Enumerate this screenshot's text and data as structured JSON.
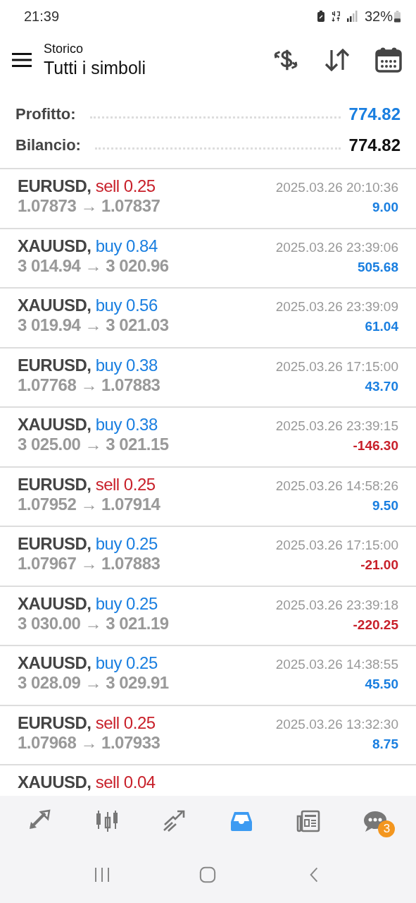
{
  "status_bar": {
    "time": "21:39",
    "battery": "32%"
  },
  "header": {
    "subtitle": "Storico",
    "title": "Tutti i simboli"
  },
  "summary": [
    {
      "label": "Profitto:",
      "value": "774.82",
      "kind": "accent"
    },
    {
      "label": "Bilancio:",
      "value": "774.82",
      "kind": "plain"
    }
  ],
  "deals": [
    {
      "symbol": "EURUSD,",
      "side": "sell",
      "kind": "sell",
      "volume": "0.25",
      "time": "2025.03.26 20:10:36",
      "prices": "1.07873 → 1.07837",
      "profit": "9.00",
      "loss": false
    },
    {
      "symbol": "XAUUSD,",
      "side": "buy",
      "kind": "buy",
      "volume": "0.84",
      "time": "2025.03.26 23:39:06",
      "prices": "3 014.94 → 3 020.96",
      "profit": "505.68",
      "loss": false
    },
    {
      "symbol": "XAUUSD,",
      "side": "buy",
      "kind": "buy",
      "volume": "0.56",
      "time": "2025.03.26 23:39:09",
      "prices": "3 019.94 → 3 021.03",
      "profit": "61.04",
      "loss": false
    },
    {
      "symbol": "EURUSD,",
      "side": "buy",
      "kind": "buy",
      "volume": "0.38",
      "time": "2025.03.26 17:15:00",
      "prices": "1.07768 → 1.07883",
      "profit": "43.70",
      "loss": false
    },
    {
      "symbol": "XAUUSD,",
      "side": "buy",
      "kind": "buy",
      "volume": "0.38",
      "time": "2025.03.26 23:39:15",
      "prices": "3 025.00 → 3 021.15",
      "profit": "-146.30",
      "loss": true
    },
    {
      "symbol": "EURUSD,",
      "side": "sell",
      "kind": "sell",
      "volume": "0.25",
      "time": "2025.03.26 14:58:26",
      "prices": "1.07952 → 1.07914",
      "profit": "9.50",
      "loss": false
    },
    {
      "symbol": "EURUSD,",
      "side": "buy",
      "kind": "buy",
      "volume": "0.25",
      "time": "2025.03.26 17:15:00",
      "prices": "1.07967 → 1.07883",
      "profit": "-21.00",
      "loss": true
    },
    {
      "symbol": "XAUUSD,",
      "side": "buy",
      "kind": "buy",
      "volume": "0.25",
      "time": "2025.03.26 23:39:18",
      "prices": "3 030.00 → 3 021.19",
      "profit": "-220.25",
      "loss": true
    },
    {
      "symbol": "XAUUSD,",
      "side": "buy",
      "kind": "buy",
      "volume": "0.25",
      "time": "2025.03.26 14:38:55",
      "prices": "3 028.09 → 3 029.91",
      "profit": "45.50",
      "loss": false
    },
    {
      "symbol": "EURUSD,",
      "side": "sell",
      "kind": "sell",
      "volume": "0.25",
      "time": "2025.03.26 13:32:30",
      "prices": "1.07968 → 1.07933",
      "profit": "8.75",
      "loss": false
    },
    {
      "symbol": "XAUUSD,",
      "side": "sell",
      "kind": "sell",
      "volume": "0.04"
    }
  ],
  "tabs": [
    {
      "kind": "quotes",
      "selected": false
    },
    {
      "kind": "chart",
      "selected": false
    },
    {
      "kind": "trade",
      "selected": false
    },
    {
      "kind": "history",
      "selected": true
    },
    {
      "kind": "news",
      "selected": false
    },
    {
      "kind": "messages",
      "selected": false,
      "badge": "3"
    }
  ]
}
